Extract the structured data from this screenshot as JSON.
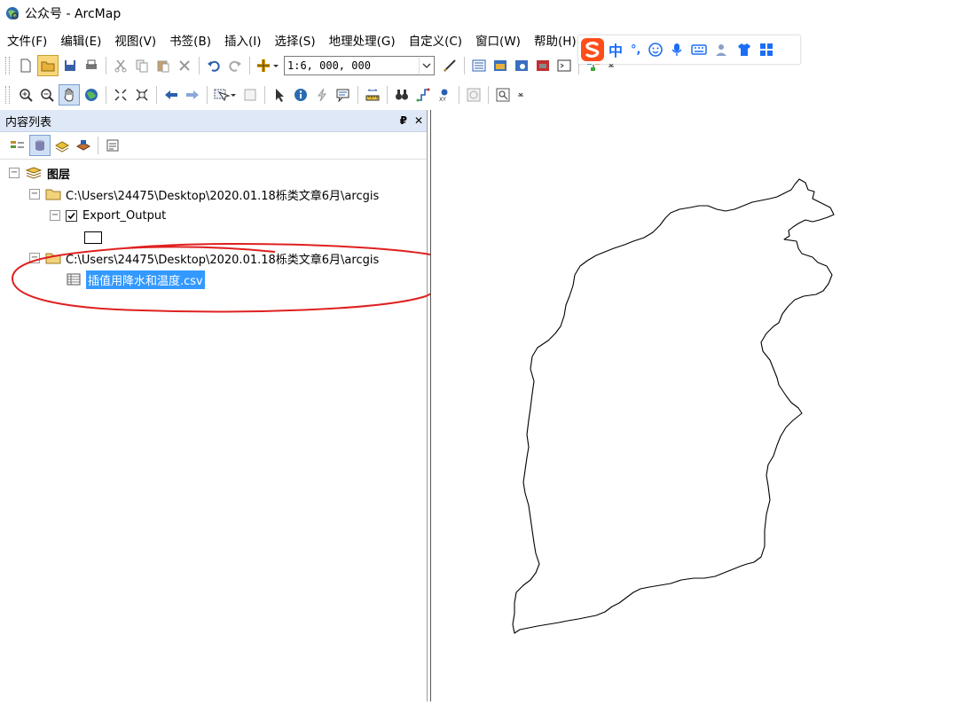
{
  "window": {
    "title": "公众号 - ArcMap"
  },
  "menu": [
    "文件(F)",
    "编辑(E)",
    "视图(V)",
    "书签(B)",
    "插入(I)",
    "选择(S)",
    "地理处理(G)",
    "自定义(C)",
    "窗口(W)",
    "帮助(H)"
  ],
  "toolbar": {
    "scale_value": "1:6, 000, 000"
  },
  "toc": {
    "title": "内容列表",
    "pin": "₽",
    "close": "✕",
    "root_label": "图层",
    "folder1_label": "C:\\Users\\24475\\Desktop\\2020.01.18栎类文章6月\\arcgis",
    "layer1_label": "Export_Output",
    "layer1_checked": true,
    "folder2_label": "C:\\Users\\24475\\Desktop\\2020.01.18栎类文章6月\\arcgis",
    "table_label": "插值用降水和温度.csv"
  },
  "ime": {
    "mode": "中",
    "punct": "°,"
  },
  "colors": {
    "annotation_red": "#e02020",
    "selection_blue": "#3399ff",
    "ime_brand": "#ff4d1a"
  }
}
